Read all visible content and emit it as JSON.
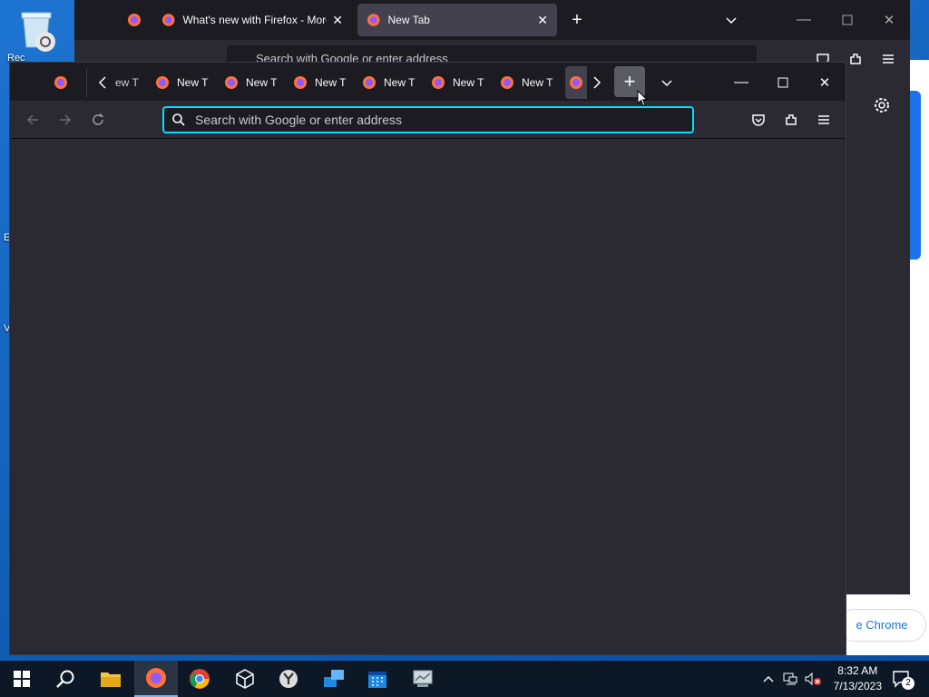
{
  "desktop": {
    "label_recycle": "Rec",
    "label_e": "E",
    "label_v": "V"
  },
  "chrome_window": {
    "button_label": "e Chrome"
  },
  "back_window": {
    "tab_1": "What's new with Firefox - More",
    "tab_2": "New Tab",
    "address_placeholder": "Search with Google or enter address"
  },
  "front_window": {
    "first_tab_partial": "ew T",
    "tabs": [
      "New T",
      "New T",
      "New T",
      "New T",
      "New T",
      "New T"
    ],
    "address_placeholder": "Search with Google or enter address",
    "address_value": ""
  },
  "taskbar": {
    "time": "8:32 AM",
    "date": "7/13/2023",
    "notification_count": "2"
  },
  "colors": {
    "tab_strip": "#1c1b22",
    "toolbar": "#2b2a33",
    "url_focus": "#00ddff",
    "desktop": "#1d74d1"
  }
}
